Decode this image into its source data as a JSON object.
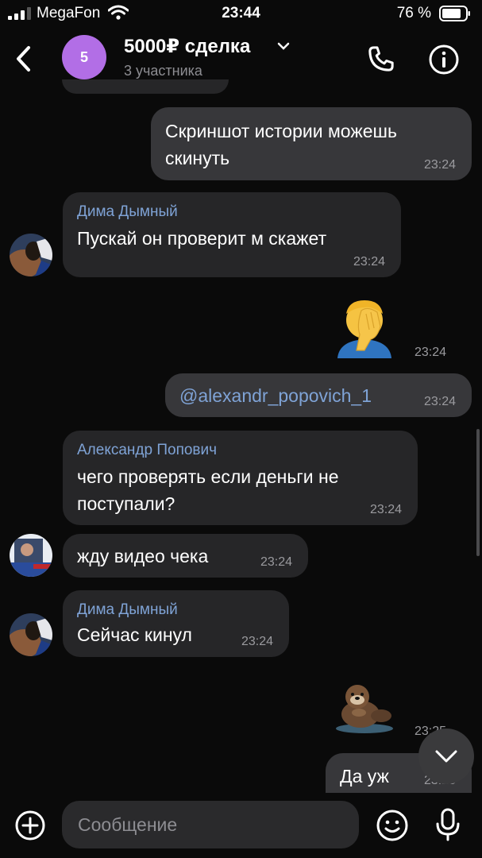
{
  "status_bar": {
    "carrier": "MegaFon",
    "time": "23:44",
    "battery": "76 %"
  },
  "header": {
    "title": "5000₽ сделка",
    "subtitle": "3 участника",
    "avatar_initial": "5"
  },
  "messages": [
    {
      "dir": "out",
      "text": "Скриншот истории можешь скинуть",
      "time": "23:24"
    },
    {
      "dir": "in",
      "sender": "Дима Дымный",
      "text": "Пускай он проверит м скажет",
      "time": "23:24"
    },
    {
      "dir": "out",
      "kind": "emoji",
      "emoji": "🤦‍♂️",
      "time": "23:24"
    },
    {
      "dir": "out",
      "mention": "@alexandr_popovich_1",
      "time": "23:24"
    },
    {
      "dir": "in",
      "sender": "Александр Попович",
      "text": "чего проверять если деньги не поступали?",
      "time": "23:24"
    },
    {
      "dir": "in",
      "text": "жду видео чека",
      "time": "23:24"
    },
    {
      "dir": "in",
      "sender": "Дима Дымный",
      "text": "Сейчас кинул",
      "time": "23:24"
    },
    {
      "dir": "out",
      "kind": "sticker",
      "sticker": "otter",
      "time": "23:25"
    },
    {
      "dir": "out",
      "text": "Да уж",
      "time": "23:25"
    }
  ],
  "composer": {
    "placeholder": "Сообщение"
  },
  "colors": {
    "sender_name": "#7fa3d6",
    "mention": "#7fa3d6",
    "chat_avatar": "#b26ee6",
    "incoming_bubble": "#262628",
    "outgoing_bubble": "#37373a"
  },
  "icons": [
    "signal-icon",
    "wifi-icon",
    "battery-icon",
    "back-chevron-icon",
    "chevron-down-icon",
    "phone-icon",
    "info-icon",
    "chevron-down-icon",
    "plus-circle-icon",
    "emoji-icon",
    "microphone-icon"
  ]
}
